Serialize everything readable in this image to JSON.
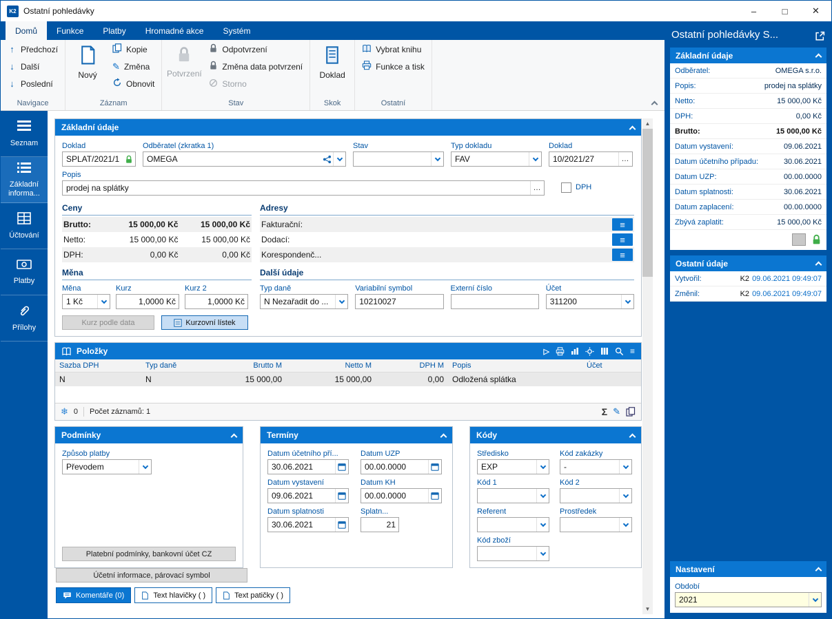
{
  "win": {
    "title": "Ostatní pohledávky",
    "min": "–",
    "max": "□",
    "close": "✕"
  },
  "ribbon": {
    "tabs": [
      {
        "label": "Domů"
      },
      {
        "label": "Funkce"
      },
      {
        "label": "Platby"
      },
      {
        "label": "Hromadné akce"
      },
      {
        "label": "Systém"
      }
    ],
    "navigace": {
      "label": "Navigace",
      "items": [
        "Předchozí",
        "Další",
        "Poslední"
      ]
    },
    "zaznam": {
      "label": "Záznam",
      "big": "Nový",
      "items": [
        "Kopie",
        "Změna",
        "Obnovit"
      ]
    },
    "stav": {
      "label": "Stav",
      "big": "Potvrzení",
      "items": [
        "Odpotvrzení",
        "Změna data potvrzení",
        "Storno"
      ]
    },
    "skok": {
      "label": "Skok",
      "big": "Doklad"
    },
    "ostatni": {
      "label": "Ostatní",
      "items": [
        "Vybrat knihu",
        "Funkce a tisk"
      ]
    }
  },
  "sidebar": {
    "items": [
      {
        "label": "Seznam"
      },
      {
        "label": "Základní informa..."
      },
      {
        "label": "Účtování"
      },
      {
        "label": "Platby"
      },
      {
        "label": "Přílohy"
      }
    ]
  },
  "basic": {
    "title": "Základní údaje",
    "doklad": {
      "label": "Doklad",
      "value": "SPLAT/2021/1"
    },
    "odberatel": {
      "label": "Odběratel (zkratka 1)",
      "value": "OMEGA"
    },
    "stav": {
      "label": "Stav",
      "value": ""
    },
    "typ_dokladu": {
      "label": "Typ dokladu",
      "value": "FAV"
    },
    "doklad2": {
      "label": "Doklad",
      "value": "10/2021/27"
    },
    "popis": {
      "label": "Popis",
      "value": "prodej na splátky"
    },
    "dph_label": "DPH",
    "ceny": {
      "title": "Ceny",
      "rows": [
        {
          "label": "Brutto:",
          "v1": "15 000,00 Kč",
          "v2": "15 000,00 Kč"
        },
        {
          "label": "Netto:",
          "v1": "15 000,00 Kč",
          "v2": "15 000,00 Kč"
        },
        {
          "label": "DPH:",
          "v1": "0,00 Kč",
          "v2": "0,00 Kč"
        }
      ]
    },
    "adresy": {
      "title": "Adresy",
      "rows": [
        {
          "label": "Fakturační:"
        },
        {
          "label": "Dodací:"
        },
        {
          "label": "Korespondenč..."
        }
      ]
    },
    "mena": {
      "title": "Měna",
      "mena": {
        "label": "Měna",
        "value": "1 Kč"
      },
      "kurz": {
        "label": "Kurz",
        "value": "1,0000 Kč"
      },
      "kurz2": {
        "label": "Kurz 2",
        "value": "1,0000 Kč"
      }
    },
    "dalsi": {
      "title": "Další údaje",
      "typ_dane": {
        "label": "Typ daně",
        "value": "N Nezařadit do ..."
      },
      "var_symbol": {
        "label": "Variabilní symbol",
        "value": "10210027"
      },
      "ext_cislo": {
        "label": "Externí číslo",
        "value": ""
      },
      "ucet": {
        "label": "Účet",
        "value": "311200"
      }
    },
    "kurz_podle_data": "Kurz podle data",
    "kurzovni_listek": "Kurzovní lístek"
  },
  "polozky": {
    "title": "Položky",
    "columns": [
      "Sazba DPH",
      "Typ daně",
      "Brutto M",
      "Netto M",
      "DPH M",
      "Popis",
      "Účet"
    ],
    "row": {
      "sazba": "N",
      "typ": "N",
      "brutto": "15 000,00",
      "netto": "15 000,00",
      "dph": "0,00",
      "popis": "Odložená splátka",
      "ucet": ""
    },
    "frozen": "0",
    "count": "Počet záznamů: 1"
  },
  "podminky": {
    "title": "Podmínky",
    "zpusob": {
      "label": "Způsob platby",
      "value": "Převodem"
    },
    "button": "Platební podmínky, bankovní účet CZ"
  },
  "terminy": {
    "title": "Termíny",
    "fields": [
      {
        "label": "Datum účetního pří...",
        "value": "30.06.2021"
      },
      {
        "label": "Datum UZP",
        "value": "00.00.0000"
      },
      {
        "label": "Datum vystavení",
        "value": "09.06.2021"
      },
      {
        "label": "Datum KH",
        "value": "00.00.0000"
      },
      {
        "label": "Datum splatnosti",
        "value": "30.06.2021"
      },
      {
        "label": "Splatn...",
        "value": "21"
      }
    ]
  },
  "kody": {
    "title": "Kódy",
    "fields": [
      {
        "label": "Středisko",
        "value": "EXP"
      },
      {
        "label": "Kód zakázky",
        "value": "-"
      },
      {
        "label": "Kód 1",
        "value": ""
      },
      {
        "label": "Kód 2",
        "value": ""
      },
      {
        "label": "Referent",
        "value": ""
      },
      {
        "label": "Prostředek",
        "value": ""
      },
      {
        "label": "Kód zboží",
        "value": ""
      }
    ]
  },
  "footer": {
    "ucetni": "Účetní informace, párovací symbol",
    "komentare": "Komentáře (0)",
    "hlavicky": "Text hlavičky ( )",
    "paticky": "Text patičky ( )"
  },
  "rp": {
    "title": "Ostatní pohledávky S...",
    "zakladni": {
      "title": "Základní údaje",
      "rows": [
        {
          "label": "Odběratel:",
          "value": "OMEGA s.r.o."
        },
        {
          "label": "Popis:",
          "value": "prodej na splátky"
        },
        {
          "label": "Netto:",
          "value": "15 000,00 Kč"
        },
        {
          "label": "DPH:",
          "value": "0,00 Kč"
        },
        {
          "label": "Brutto:",
          "value": "15 000,00 Kč"
        },
        {
          "label": "Datum vystavení:",
          "value": "09.06.2021"
        },
        {
          "label": "Datum účetního případu:",
          "value": "30.06.2021"
        },
        {
          "label": "Datum UZP:",
          "value": "00.00.0000"
        },
        {
          "label": "Datum splatnosti:",
          "value": "30.06.2021"
        },
        {
          "label": "Datum zaplacení:",
          "value": "00.00.0000"
        },
        {
          "label": "Zbývá zaplatit:",
          "value": "15 000,00 Kč"
        }
      ]
    },
    "ostatni": {
      "title": "Ostatní údaje",
      "rows": [
        {
          "label": "Vytvořil:",
          "user": "K2",
          "value": "09.06.2021 09:49:07"
        },
        {
          "label": "Změnil:",
          "user": "K2",
          "value": "09.06.2021 09:49:07"
        }
      ]
    },
    "nastaveni": {
      "title": "Nastavení",
      "obdobi": {
        "label": "Období",
        "value": "2021"
      }
    }
  }
}
